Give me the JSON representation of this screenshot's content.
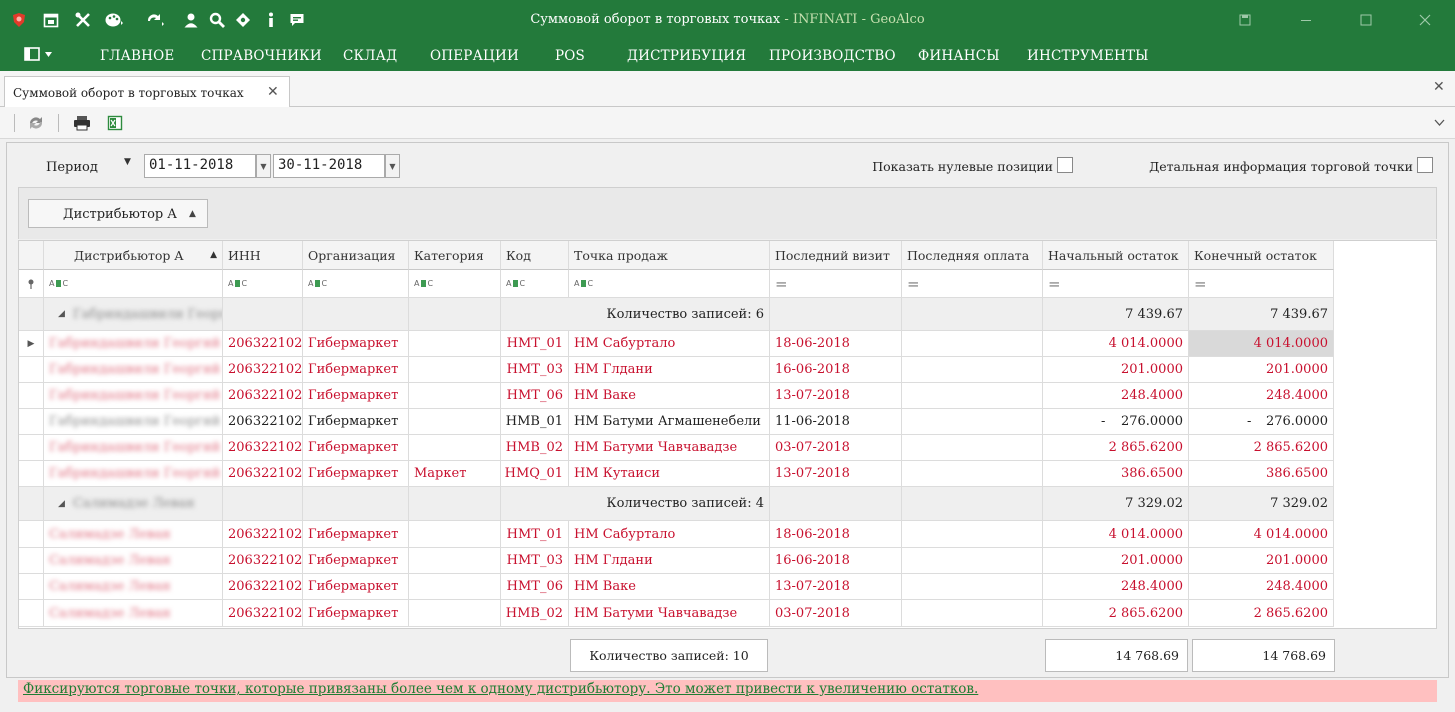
{
  "window": {
    "title": "Суммовой оборот в торговых точках",
    "app_suffix": " - INFINATI - GeoAlco",
    "colors": {
      "titlebar": "#237a3b",
      "accent_text": "#c7e0b0",
      "red_text": "#c8102e",
      "warning_bg": "#ffc0c0",
      "warning_text": "#1e7d34"
    }
  },
  "menu": {
    "items": [
      "ГЛАВНОЕ",
      "СПРАВОЧНИКИ",
      "СКЛАД",
      "ОПЕРАЦИИ",
      "POS",
      "ДИСТРИБУЦИЯ",
      "ПРОИЗВОДСТВО",
      "ФИНАНСЫ",
      "ИНСТРУМЕНТЫ"
    ]
  },
  "tab": {
    "label": "Суммовой оборот в торговых точках",
    "close": "✕"
  },
  "strip_close": "✕",
  "filters": {
    "period_label": "Период",
    "date_from": "01-11-2018",
    "date_to": "30-11-2018",
    "show_zero_label": "Показать нулевые позиции",
    "detail_label": "Детальная информация торговой точки"
  },
  "group_panel": {
    "chip_label": "Дистрибьютор A"
  },
  "grid": {
    "columns": [
      "Дистрибьютор A",
      "ИНН",
      "Организация",
      "Категория",
      "Код",
      "Точка продаж",
      "Последний визит",
      "Последняя оплата",
      "Начальный остаток",
      "Конечный остаток"
    ],
    "groups": [
      {
        "name": "Габриндашвили Георгий",
        "summary": "Количество записей: 6",
        "start_total": "7 439.67",
        "end_total": "7 439.67",
        "rows": [
          {
            "dist": "Габриндашвили Георгий",
            "inn": "206322102",
            "org": "Гибермаркет",
            "cat": "",
            "code": "HMT_01",
            "point": "HM Сабуртало",
            "visit": "18-06-2018",
            "payment": "",
            "start": "4 014.0000",
            "end": "4 014.0000",
            "color": "red"
          },
          {
            "dist": "Габриндашвили Георгий",
            "inn": "206322102",
            "org": "Гибермаркет",
            "cat": "",
            "code": "HMT_03",
            "point": "HM Глдани",
            "visit": "16-06-2018",
            "payment": "",
            "start": "201.0000",
            "end": "201.0000",
            "color": "red"
          },
          {
            "dist": "Габриндашвили Георгий",
            "inn": "206322102",
            "org": "Гибермаркет",
            "cat": "",
            "code": "HMT_06",
            "point": "HM Ваке",
            "visit": "13-07-2018",
            "payment": "",
            "start": "248.4000",
            "end": "248.4000",
            "color": "red"
          },
          {
            "dist": "Габриндашвили Георгий",
            "inn": "206322102",
            "org": "Гибермаркет",
            "cat": "",
            "code": "HMB_01",
            "point": "HM Батуми Агмашенебели",
            "visit": "11-06-2018",
            "payment": "",
            "start_sign": "-",
            "start": "276.0000",
            "end_sign": "-",
            "end": "276.0000",
            "color": "black"
          },
          {
            "dist": "Габриндашвили Георгий",
            "inn": "206322102",
            "org": "Гибермаркет",
            "cat": "",
            "code": "HMB_02",
            "point": "HM Батуми Чавчавадзе",
            "visit": "03-07-2018",
            "payment": "",
            "start": "2 865.6200",
            "end": "2 865.6200",
            "color": "red"
          },
          {
            "dist": "Габриндашвили Георгий",
            "inn": "206322102",
            "org": "Гибермаркет",
            "cat": "Маркет",
            "code": "HMQ_01",
            "point": "HM  Кутаиси",
            "visit": "13-07-2018",
            "payment": "",
            "start": "386.6500",
            "end": "386.6500",
            "color": "red"
          }
        ]
      },
      {
        "name": "Салимадзе Леван",
        "summary": "Количество записей: 4",
        "start_total": "7 329.02",
        "end_total": "7 329.02",
        "rows": [
          {
            "dist": "Салимадзе Леван",
            "inn": "206322102",
            "org": "Гибермаркет",
            "cat": "",
            "code": "HMT_01",
            "point": "HM Сабуртало",
            "visit": "18-06-2018",
            "payment": "",
            "start": "4 014.0000",
            "end": "4 014.0000",
            "color": "red"
          },
          {
            "dist": "Салимадзе Леван",
            "inn": "206322102",
            "org": "Гибермаркет",
            "cat": "",
            "code": "HMT_03",
            "point": "HM Глдани",
            "visit": "16-06-2018",
            "payment": "",
            "start": "201.0000",
            "end": "201.0000",
            "color": "red"
          },
          {
            "dist": "Салимадзе Леван",
            "inn": "206322102",
            "org": "Гибермаркет",
            "cat": "",
            "code": "HMT_06",
            "point": "HM Ваке",
            "visit": "13-07-2018",
            "payment": "",
            "start": "248.4000",
            "end": "248.4000",
            "color": "red"
          },
          {
            "dist": "Салимадзе Леван",
            "inn": "206322102",
            "org": "Гибермаркет",
            "cat": "",
            "code": "HMB_02",
            "point": "HM Батуми Чавчавадзе",
            "visit": "03-07-2018",
            "payment": "",
            "start": "2 865.6200",
            "end": "2 865.6200",
            "color": "red"
          }
        ]
      }
    ]
  },
  "footer": {
    "count": "Количество записей: 10",
    "start_total": "14 768.69",
    "end_total": "14 768.69"
  },
  "warning": "Фиксируются торговые точки, которые привязаны более чем к одному дистрибьютору. Это может привести к увеличению остатков.",
  "icons": [
    "app-shield-icon",
    "calendar-icon",
    "tools-icon",
    "palette-icon",
    "refresh-icon",
    "user-icon",
    "search-icon",
    "puzzle-icon",
    "info-icon",
    "chat-icon",
    "sidebar-toggle-icon",
    "print-icon",
    "excel-icon",
    "filter-pin-icon",
    "expand-row-icon"
  ]
}
